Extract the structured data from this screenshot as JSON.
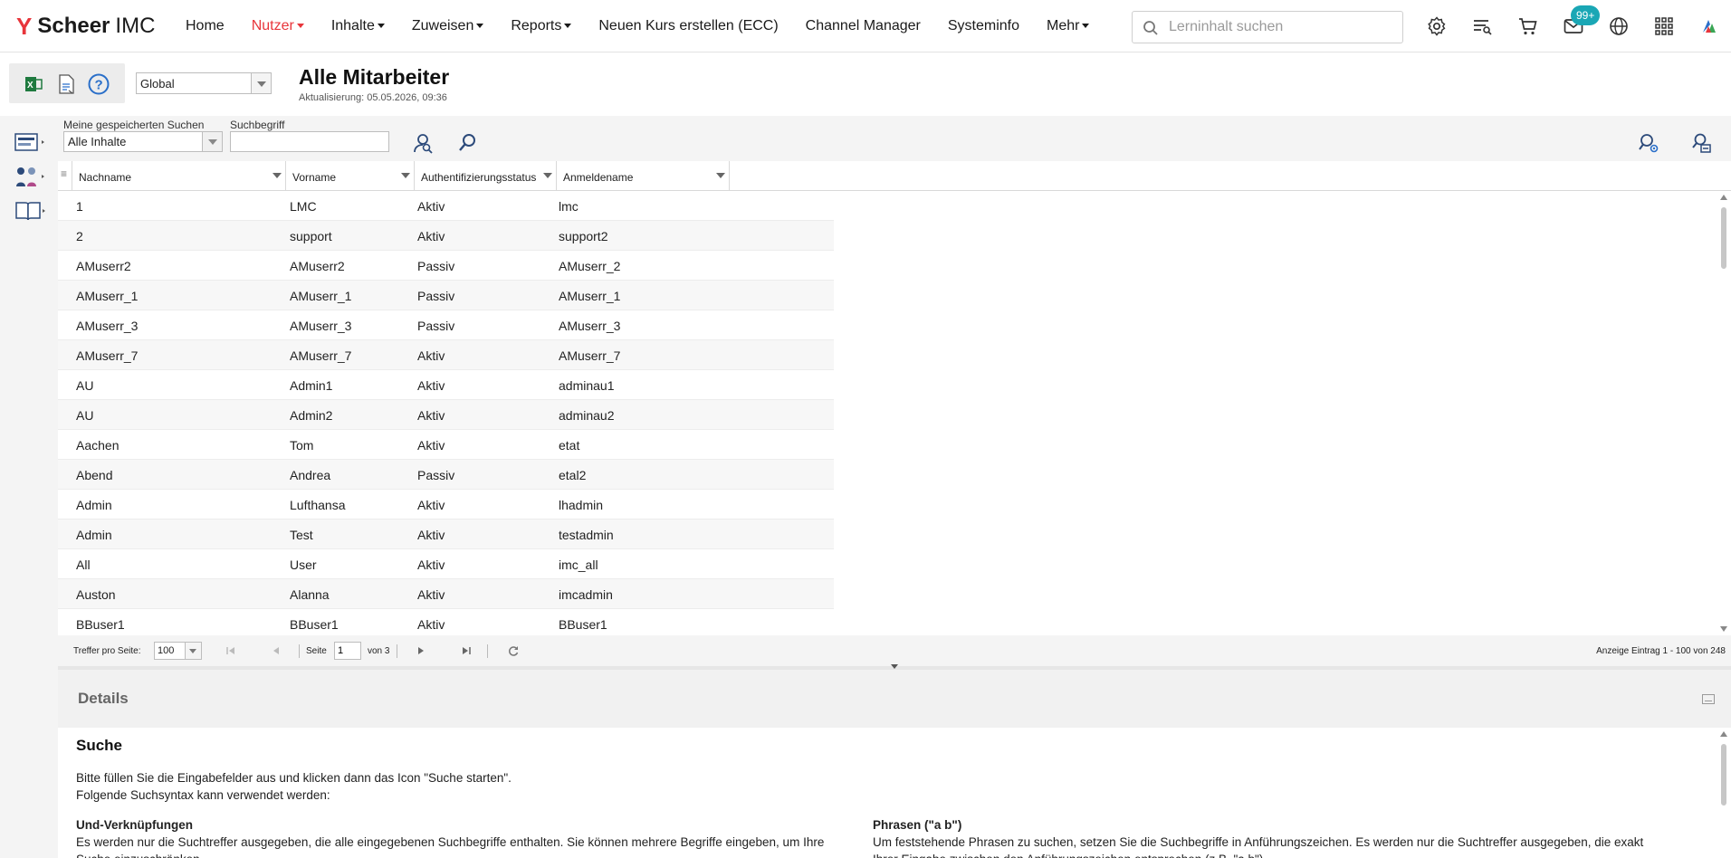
{
  "brand": {
    "name_bold": "Scheer",
    "name_light": "IMC"
  },
  "nav": {
    "items": [
      {
        "label": "Home",
        "active": false,
        "dropdown": false
      },
      {
        "label": "Nutzer",
        "active": true,
        "dropdown": true
      },
      {
        "label": "Inhalte",
        "active": false,
        "dropdown": true
      },
      {
        "label": "Zuweisen",
        "active": false,
        "dropdown": true
      },
      {
        "label": "Reports",
        "active": false,
        "dropdown": true
      },
      {
        "label": "Neuen Kurs erstellen (ECC)",
        "active": false,
        "dropdown": false
      },
      {
        "label": "Channel Manager",
        "active": false,
        "dropdown": false
      },
      {
        "label": "Systeminfo",
        "active": false,
        "dropdown": false
      },
      {
        "label": "Mehr",
        "active": false,
        "dropdown": true
      }
    ],
    "search_placeholder": "Lerninhalt suchen",
    "notification_badge": "99+",
    "icons": [
      "settings-icon",
      "tasks-icon",
      "cart-icon",
      "mail-icon",
      "globe-icon",
      "apps-grid-icon",
      "imc-logo-icon"
    ]
  },
  "colors": {
    "accent": "#e8353b",
    "badge": "#1aa7b5"
  },
  "subheader": {
    "scope_select": "Global",
    "title": "Alle Mitarbeiter",
    "updated": "Aktualisierung: 05.05.2026, 09:36",
    "toolbox_icons": [
      "excel-export-icon",
      "pdf-export-icon",
      "help-icon"
    ]
  },
  "filters": {
    "saved_searches_label": "Meine gespeicherten Suchen",
    "saved_searches_value": "Alle Inhalte",
    "term_label": "Suchbegriff",
    "term_value": ""
  },
  "grid": {
    "columns": [
      "Nachname",
      "Vorname",
      "Authentifizierungsstatus",
      "Anmeldename"
    ],
    "rows": [
      [
        "1",
        "LMC",
        "Aktiv",
        "lmc"
      ],
      [
        "2",
        "support",
        "Aktiv",
        "support2"
      ],
      [
        "AMuserr2",
        "AMuserr2",
        "Passiv",
        "AMuserr_2"
      ],
      [
        "AMuserr_1",
        "AMuserr_1",
        "Passiv",
        "AMuserr_1"
      ],
      [
        "AMuserr_3",
        "AMuserr_3",
        "Passiv",
        "AMuserr_3"
      ],
      [
        "AMuserr_7",
        "AMuserr_7",
        "Aktiv",
        "AMuserr_7"
      ],
      [
        "AU",
        "Admin1",
        "Aktiv",
        "adminau1"
      ],
      [
        "AU",
        "Admin2",
        "Aktiv",
        "adminau2"
      ],
      [
        "Aachen",
        "Tom",
        "Aktiv",
        "etat"
      ],
      [
        "Abend",
        "Andrea",
        "Passiv",
        "etal2"
      ],
      [
        "Admin",
        "Lufthansa",
        "Aktiv",
        "lhadmin"
      ],
      [
        "Admin",
        "Test",
        "Aktiv",
        "testadmin"
      ],
      [
        "All",
        "User",
        "Aktiv",
        "imc_all"
      ],
      [
        "Auston",
        "Alanna",
        "Aktiv",
        "imcadmin"
      ],
      [
        "BBuser1",
        "BBuser1",
        "Aktiv",
        "BBuser1"
      ]
    ]
  },
  "pager": {
    "per_page_label": "Treffer pro Seite:",
    "per_page_value": "100",
    "page_label": "Seite",
    "page_value": "1",
    "of_label": "von 3",
    "summary": "Anzeige Eintrag 1 - 100 von 248"
  },
  "details": {
    "title": "Details",
    "heading": "Suche",
    "intro_1": "Bitte füllen Sie die Eingabefelder aus und klicken dann das Icon \"Suche starten\".",
    "intro_2": "Folgende Suchsyntax kann verwendet werden:",
    "and_title": "Und-Verknüpfungen",
    "and_text_1": "Es werden nur die Suchtreffer ausgegeben, die alle eingegebenen Suchbegriffe enthalten. Sie können mehrere Begriffe eingeben, um Ihre",
    "and_text_2": "Suche einzuschränken.",
    "phrase_title": "Phrasen (\"a b\")",
    "phrase_text_1": "Um feststehende Phrasen zu suchen, setzen Sie die Suchbegriffe in Anführungszeichen. Es werden nur die Suchtreffer ausgegeben, die exakt",
    "phrase_text_2": "Ihrer Eingabe zwischen den Anführungszeichen entsprechen (z.B. \"a b\")."
  }
}
